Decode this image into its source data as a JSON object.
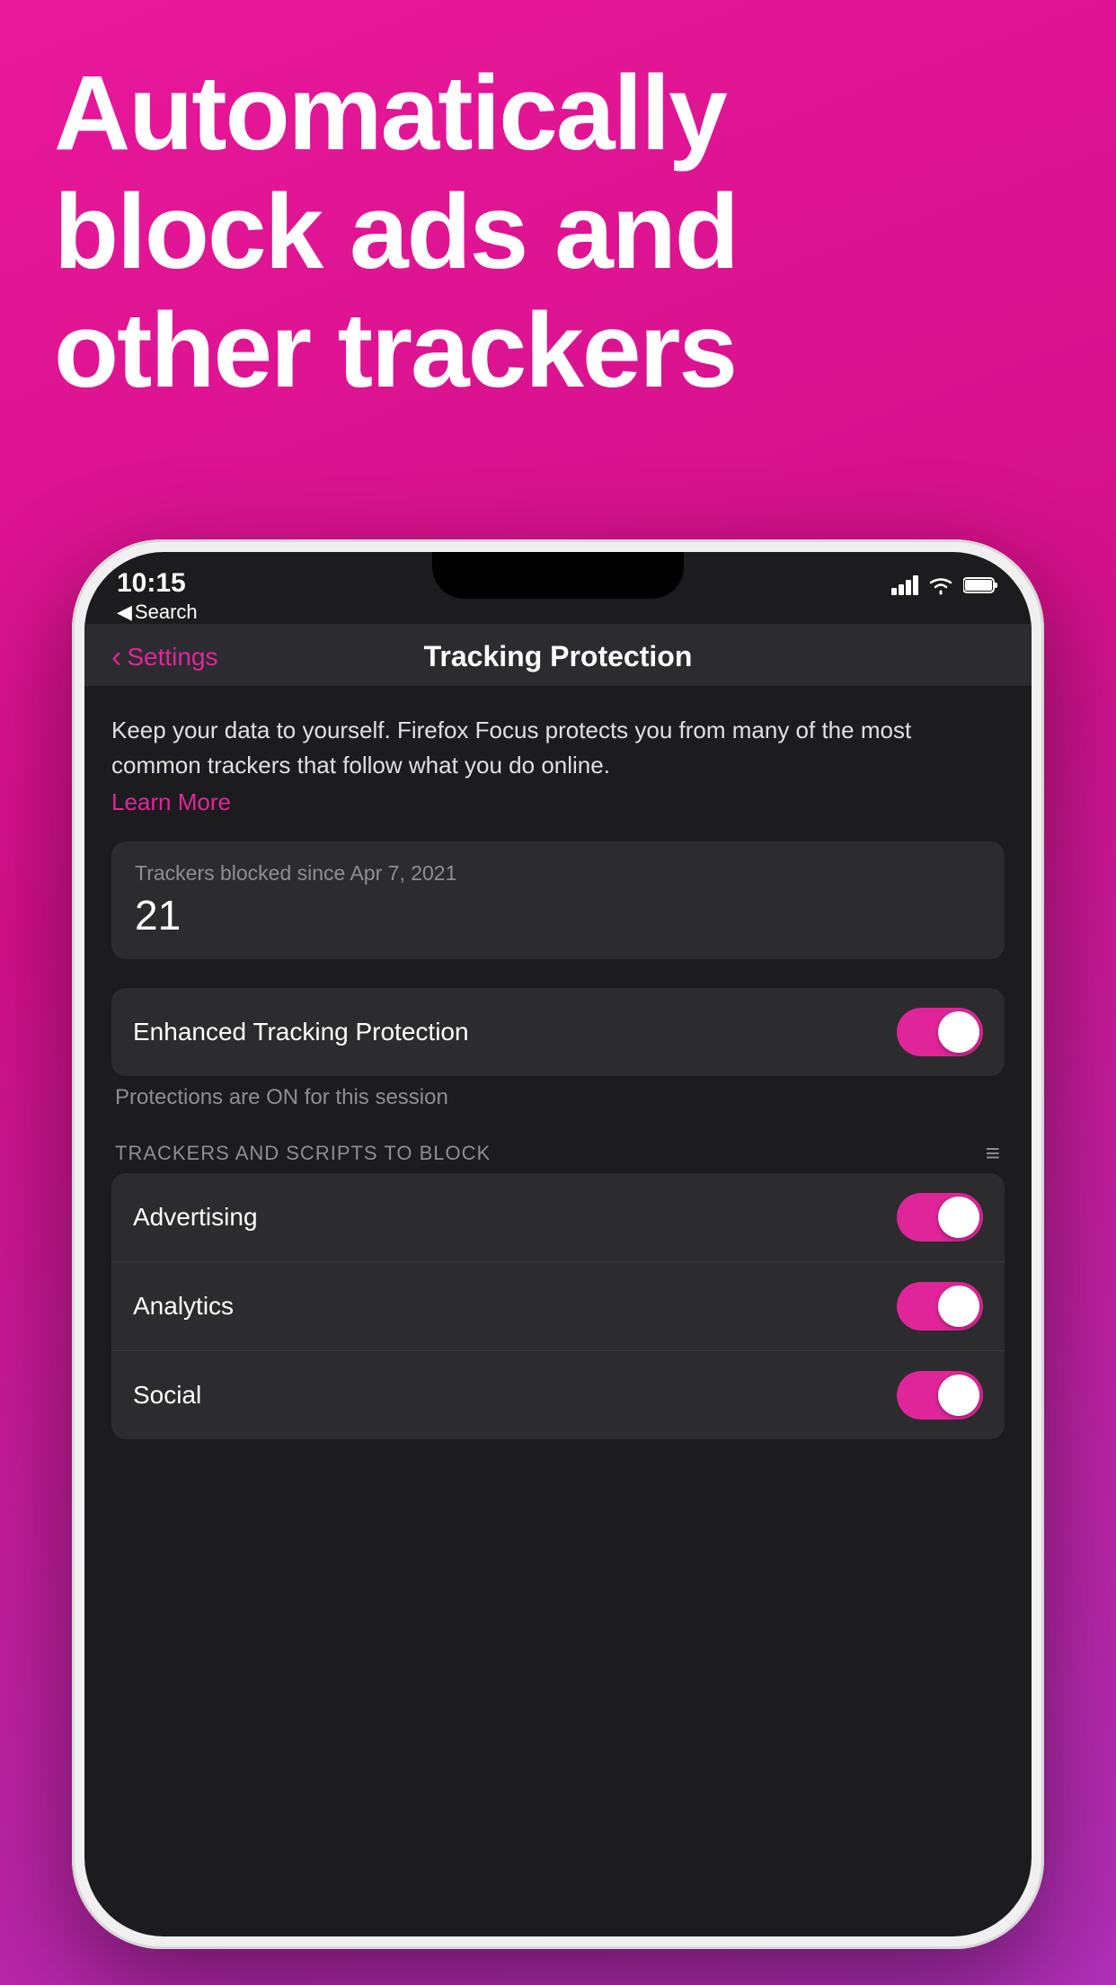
{
  "headline": {
    "line1": "Automatically",
    "line2": "block ads and",
    "line3": "other trackers"
  },
  "phone": {
    "statusBar": {
      "time": "10:15",
      "back": "Search"
    },
    "navBar": {
      "backLabel": "Settings",
      "title": "Tracking Protection"
    },
    "description": "Keep your data to yourself. Firefox Focus protects you from many of the most common trackers that follow what you do online.",
    "learnMore": "Learn More",
    "trackersCard": {
      "label": "Trackers blocked since Apr 7, 2021",
      "count": "21"
    },
    "enhancedToggle": {
      "label": "Enhanced Tracking Protection",
      "enabled": true
    },
    "protectionsStatus": "Protections are ON for this session",
    "sectionHeader": "TRACKERS AND SCRIPTS TO BLOCK",
    "trackersList": [
      {
        "label": "Advertising",
        "enabled": true
      },
      {
        "label": "Analytics",
        "enabled": true
      },
      {
        "label": "Social",
        "enabled": true
      }
    ]
  },
  "colors": {
    "accent": "#e0259a",
    "background": "#1c1c1e",
    "card": "#2c2c2e",
    "textPrimary": "#ffffff",
    "textSecondary": "#8e8e93",
    "toggleOn": "#e0259a"
  }
}
